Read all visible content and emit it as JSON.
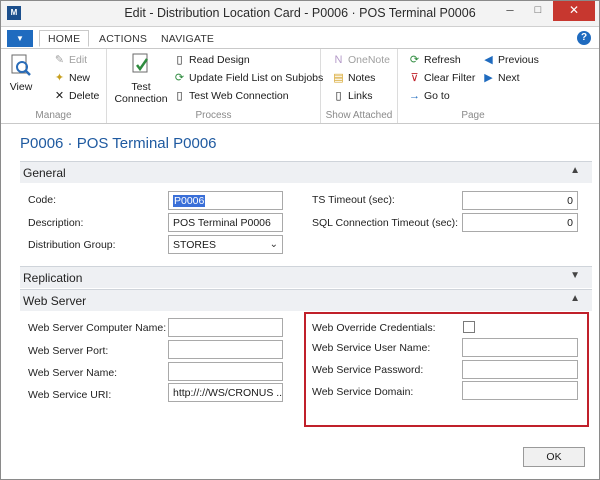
{
  "window": {
    "title": "Edit - Distribution Location Card - P0006 · POS Terminal P0006",
    "logo": "M",
    "controls": {
      "minimize": "–",
      "maximize": "□",
      "close": "✕"
    }
  },
  "ribbon_tabs": [
    {
      "label": "HOME"
    },
    {
      "label": "ACTIONS"
    },
    {
      "label": "NAVIGATE"
    }
  ],
  "help_label": "?",
  "ribbon": {
    "manage": {
      "label": "Manage",
      "view": "View",
      "edit": "Edit",
      "new": "New",
      "delete": "Delete"
    },
    "process": {
      "label": "Process",
      "test_connection_1": "Test",
      "test_connection_2": "Connection",
      "read_design": "Read Design",
      "update_field_list": "Update Field List on Subjobs",
      "test_web_connection": "Test Web Connection"
    },
    "show_attached": {
      "label": "Show Attached",
      "onenote": "OneNote",
      "notes": "Notes",
      "links": "Links"
    },
    "page": {
      "label": "Page",
      "refresh": "Refresh",
      "clear_filter": "Clear Filter",
      "go_to": "Go to",
      "previous": "Previous",
      "next": "Next"
    }
  },
  "page_title": "P0006 · POS Terminal P0006",
  "general": {
    "header": "General",
    "code_label": "Code:",
    "code_value": "P0006",
    "description_label": "Description:",
    "description_value": "POS Terminal P0006",
    "distribution_group_label": "Distribution Group:",
    "distribution_group_value": "STORES",
    "ts_timeout_label": "TS Timeout (sec):",
    "ts_timeout_value": "0",
    "sql_timeout_label": "SQL Connection Timeout (sec):",
    "sql_timeout_value": "0"
  },
  "replication": {
    "header": "Replication"
  },
  "web_server": {
    "header": "Web Server",
    "computer_name_label": "Web Server Computer Name:",
    "computer_name_value": "",
    "port_label": "Web Server Port:",
    "port_value": "",
    "server_name_label": "Web Server Name:",
    "server_name_value": "",
    "uri_label": "Web Service URI:",
    "uri_value": "http://://WS/CRONUS ...",
    "override_credentials_label": "Web Override Credentials:",
    "override_credentials_checked": false,
    "user_name_label": "Web Service User Name:",
    "user_name_value": "",
    "password_label": "Web Service Password:",
    "password_value": "",
    "domain_label": "Web Service Domain:",
    "domain_value": ""
  },
  "ok_button": "OK",
  "colors": {
    "accent": "#1f6bbf",
    "title_blue": "#1f5aa0",
    "highlight_red": "#c0202a",
    "close_red": "#c7372f"
  }
}
